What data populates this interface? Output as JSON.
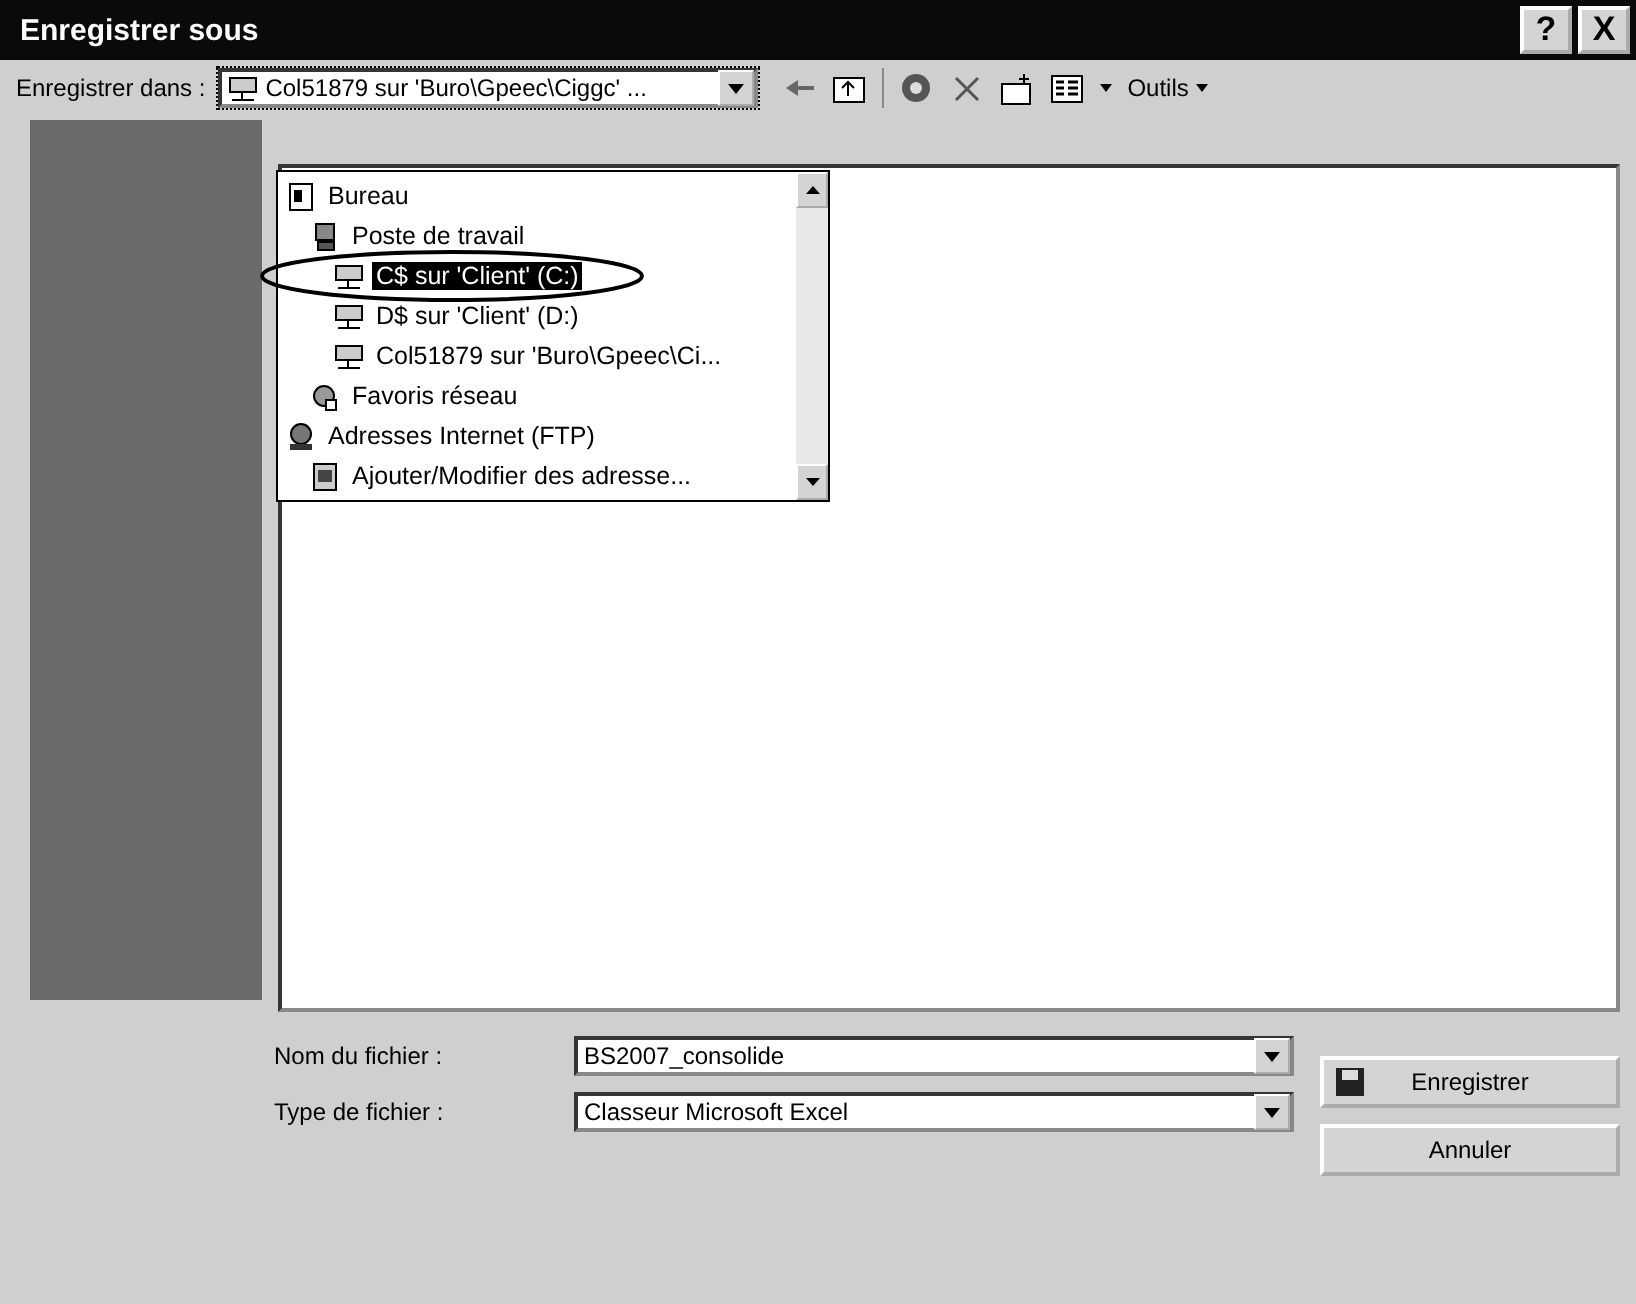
{
  "window": {
    "title": "Enregistrer sous",
    "help_button": "?",
    "close_button": "X"
  },
  "location": {
    "label": "Enregistrer dans :",
    "value": "Col51879 sur 'Buro\\Gpeec\\Ciggc' ...",
    "expanded": true
  },
  "toolbar": {
    "tools_menu": "Outils"
  },
  "location_list": [
    {
      "label": "Bureau",
      "kind": "desktop",
      "selected": false,
      "children": [
        {
          "label": "Poste de travail",
          "kind": "computer",
          "selected": false,
          "children": [
            {
              "label": "C$ sur 'Client' (C:)",
              "kind": "drive",
              "selected": true
            },
            {
              "label": "D$ sur 'Client' (D:)",
              "kind": "drive",
              "selected": false
            },
            {
              "label": "Col51879 sur 'Buro\\Gpeec\\Ci...",
              "kind": "drive",
              "selected": false
            }
          ]
        },
        {
          "label": "Favoris réseau",
          "kind": "network",
          "selected": false
        }
      ]
    },
    {
      "label": "Adresses Internet (FTP)",
      "kind": "globe",
      "selected": false,
      "children": [
        {
          "label": "Ajouter/Modifier des adresse...",
          "kind": "page",
          "selected": false
        }
      ]
    }
  ],
  "filename": {
    "label": "Nom du fichier :",
    "value": "BS2007_consolide"
  },
  "filetype": {
    "label": "Type de fichier :",
    "value": "Classeur Microsoft Excel"
  },
  "buttons": [
    {
      "label": "Enregistrer",
      "kind": "save"
    },
    {
      "label": "Annuler",
      "kind": "cancel"
    }
  ]
}
